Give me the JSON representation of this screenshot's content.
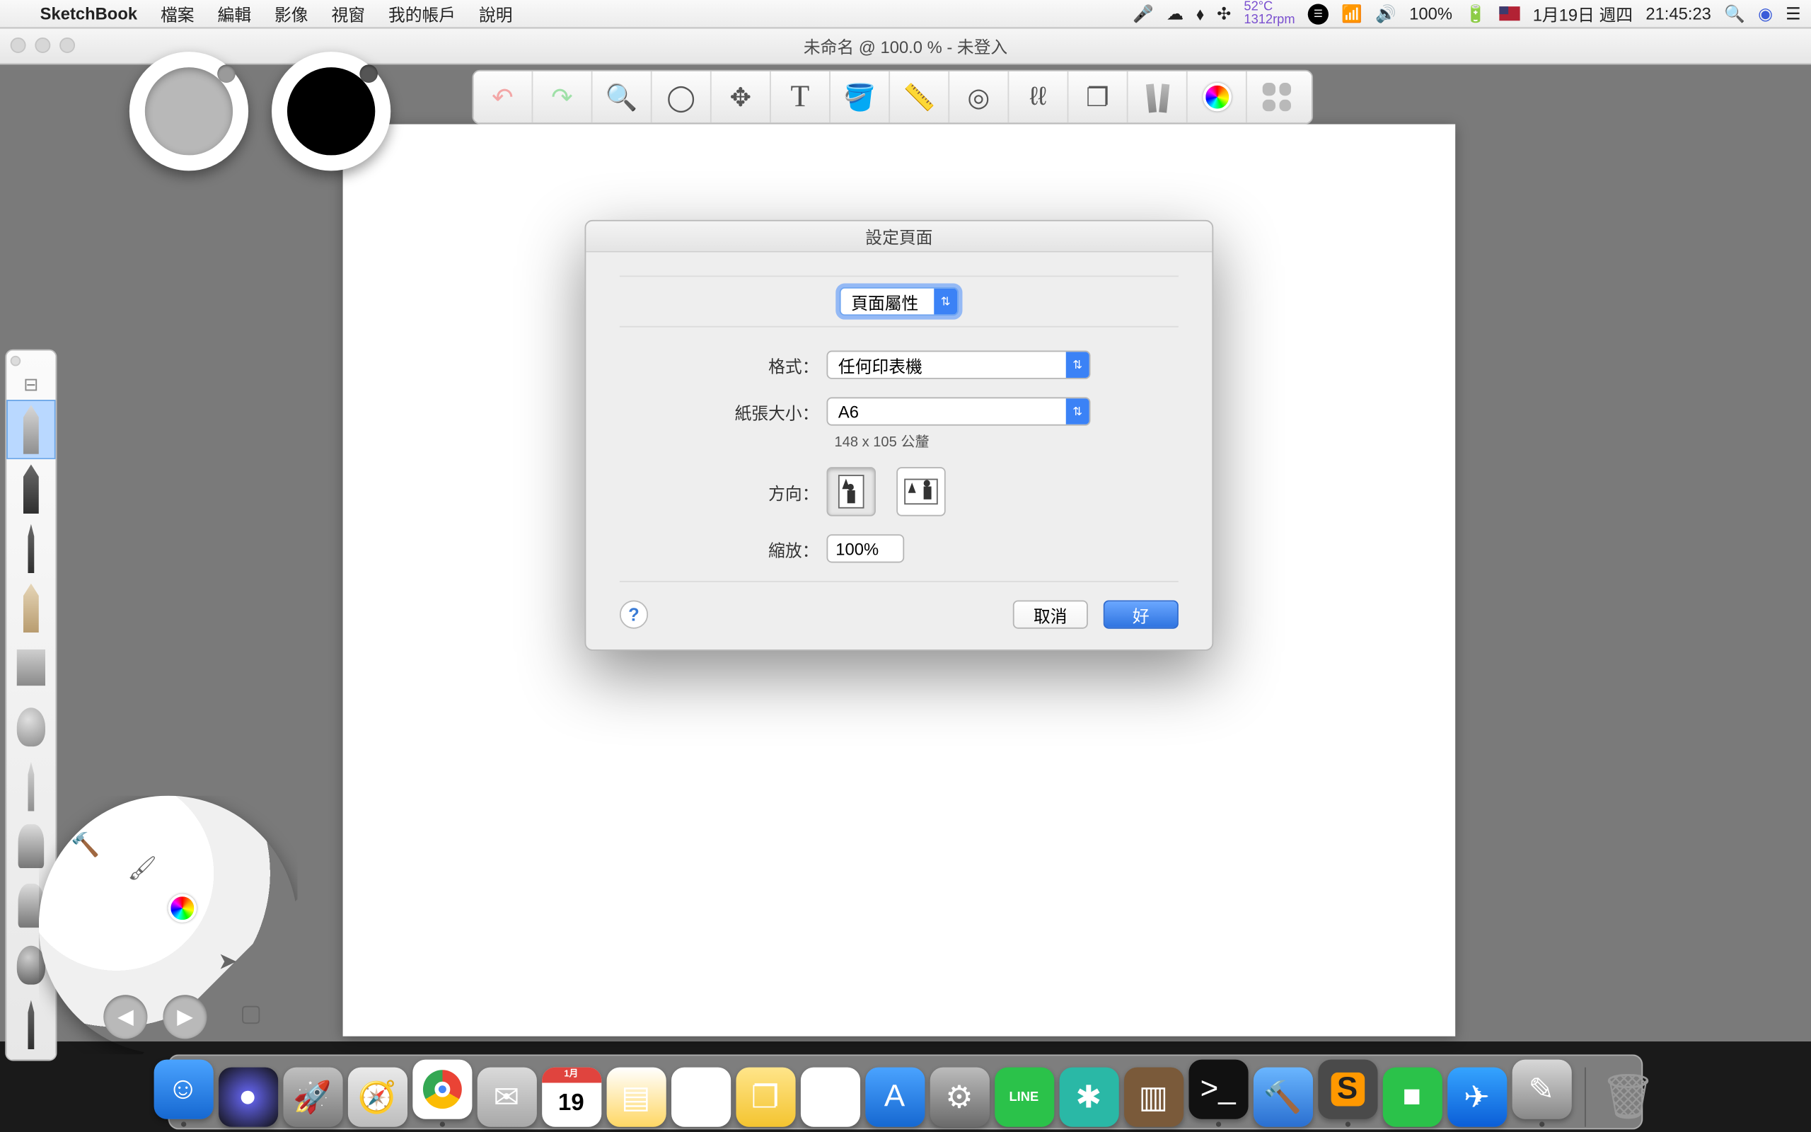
{
  "menubar": {
    "app_name": "SketchBook",
    "items": [
      "檔案",
      "編輯",
      "影像",
      "視窗",
      "我的帳戶",
      "說明"
    ],
    "status": {
      "temp_line1": "52°C",
      "temp_line2": "1312rpm",
      "battery_pct": "100%",
      "date": "1月19日 週四",
      "time": "21:45:23"
    }
  },
  "window": {
    "title": "未命名 @ 100.0 % - 未登入"
  },
  "toolbar": {
    "items": [
      {
        "name": "undo-icon",
        "glyph": "↶"
      },
      {
        "name": "redo-icon",
        "glyph": "↷"
      },
      {
        "name": "zoom-icon",
        "glyph": "🔍"
      },
      {
        "name": "lasso-icon",
        "glyph": "◯"
      },
      {
        "name": "move-icon",
        "glyph": "✥"
      },
      {
        "name": "text-icon",
        "glyph": "T"
      },
      {
        "name": "bucket-icon",
        "glyph": "🪣"
      },
      {
        "name": "ruler-icon",
        "glyph": "📏"
      },
      {
        "name": "ellipse-guide-icon",
        "glyph": "◎"
      },
      {
        "name": "symmetry-icon",
        "glyph": "§"
      },
      {
        "name": "layers-icon",
        "glyph": "❐"
      },
      {
        "name": "brushes-icon",
        "glyph": ""
      },
      {
        "name": "color-wheel-icon",
        "glyph": ""
      },
      {
        "name": "library-icon",
        "glyph": ""
      }
    ]
  },
  "color_pucks": {
    "left_hex": "#b8b8b8",
    "right_hex": "#000000"
  },
  "brush_palette": {
    "tools": [
      {
        "name": "pencil-tool",
        "selected": true
      },
      {
        "name": "airbrush-tool"
      },
      {
        "name": "marker-tool"
      },
      {
        "name": "chisel-tool"
      },
      {
        "name": "flat-brush-tool"
      },
      {
        "name": "round-brush-tool"
      },
      {
        "name": "ink-tool"
      },
      {
        "name": "paint-brush-tool"
      },
      {
        "name": "bristle-brush-tool"
      },
      {
        "name": "smudge-tool"
      },
      {
        "name": "eraser-tool"
      }
    ]
  },
  "lagoon": {
    "segments": [
      {
        "name": "hammer-icon"
      },
      {
        "name": "brush-seg-icon"
      },
      {
        "name": "color-wheel-icon"
      },
      {
        "name": "pointer-icon"
      },
      {
        "name": "canvas-icon"
      }
    ]
  },
  "dialog": {
    "title": "設定頁面",
    "dropdown_label": "頁面屬性",
    "format_label": "格式：",
    "format_value": "任何印表機",
    "paper_label": "紙張大小：",
    "paper_value": "A6",
    "paper_dims": "148 x 105 公釐",
    "orientation_label": "方向：",
    "scale_label": "縮放：",
    "scale_value": "100%",
    "cancel": "取消",
    "ok": "好"
  },
  "dock": {
    "apps": [
      {
        "name": "finder",
        "bg": "linear-gradient(#4aa3ff,#1668d1)",
        "glyph": "☺"
      },
      {
        "name": "siri",
        "bg": "radial-gradient(circle,#6a6aff,#111)",
        "glyph": "●"
      },
      {
        "name": "launchpad",
        "bg": "linear-gradient(#c0c0c0,#7a7a7a)",
        "glyph": "🚀"
      },
      {
        "name": "safari",
        "bg": "linear-gradient(#eaeaea,#bcbcbc)",
        "glyph": "🧭"
      },
      {
        "name": "chrome",
        "bg": "#fff",
        "glyph": "◉"
      },
      {
        "name": "mail",
        "bg": "linear-gradient(#dadada,#a8a8a8)",
        "glyph": "✉"
      },
      {
        "name": "calendar",
        "bg": "#fff",
        "glyph": "19"
      },
      {
        "name": "notes",
        "bg": "linear-gradient(#fff,#ffd764)",
        "glyph": "▤"
      },
      {
        "name": "reminders",
        "bg": "#fff",
        "glyph": "☑"
      },
      {
        "name": "stickies",
        "bg": "linear-gradient(#ffe58a,#f4c430)",
        "glyph": "❐"
      },
      {
        "name": "itunes",
        "bg": "#fff",
        "glyph": "♪"
      },
      {
        "name": "appstore",
        "bg": "linear-gradient(#4aa3ff,#1668d1)",
        "glyph": "A"
      },
      {
        "name": "system-preferences",
        "bg": "linear-gradient(#bcbcbc,#6a6a6a)",
        "glyph": "⚙"
      },
      {
        "name": "line",
        "bg": "#2bc24a",
        "glyph": "LINE"
      },
      {
        "name": "app-teal",
        "bg": "#2ab8a6",
        "glyph": "✱"
      },
      {
        "name": "app-bars",
        "bg": "#7a5a3a",
        "glyph": "▥"
      },
      {
        "name": "terminal",
        "bg": "#111",
        "glyph": ">_"
      },
      {
        "name": "xcode",
        "bg": "linear-gradient(#6ab6ff,#2a6fd0)",
        "glyph": "🔨"
      },
      {
        "name": "sublime",
        "bg": "#4a4a4a",
        "glyph": "S"
      },
      {
        "name": "facetime",
        "bg": "#2bc24a",
        "glyph": "■"
      },
      {
        "name": "messenger",
        "bg": "linear-gradient(#35a4ff,#0b5ed7)",
        "glyph": "✈"
      },
      {
        "name": "sketchbook",
        "bg": "linear-gradient(#d8d8d8,#888)",
        "glyph": "✎"
      }
    ],
    "trash": {
      "name": "trash",
      "glyph": "🗑"
    }
  }
}
